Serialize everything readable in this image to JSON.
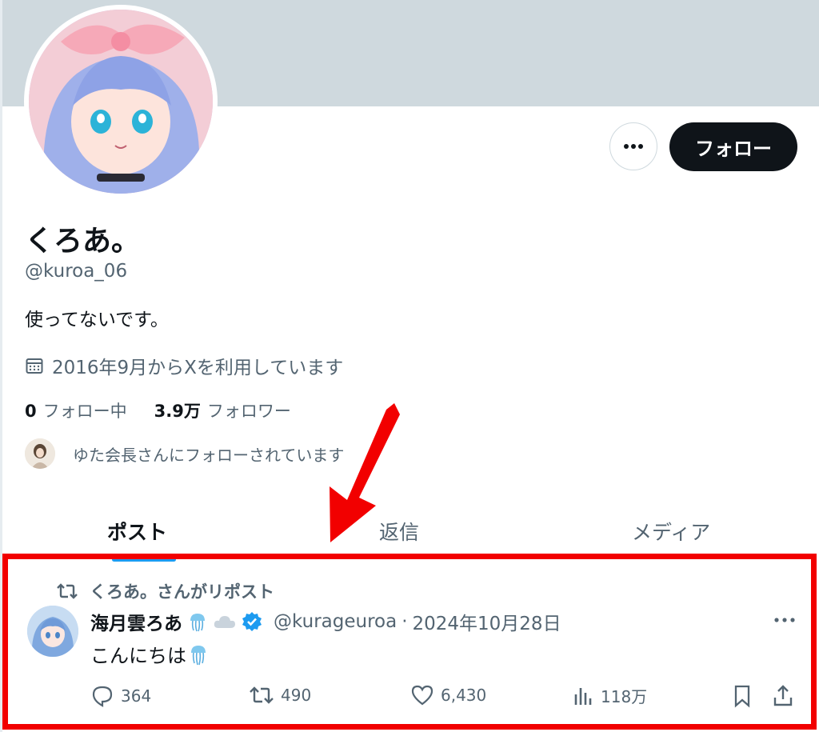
{
  "profile": {
    "display_name": "くろあ。",
    "handle": "@kuroa_06",
    "bio": "使ってないです。",
    "joined": "2016年9月からXを利用しています",
    "following_count": "0",
    "following_label": "フォロー中",
    "followers_count": "3.9万",
    "followers_label": "フォロワー",
    "followed_by": "ゆた会長さんにフォローされています"
  },
  "actions": {
    "follow_label": "フォロー",
    "more_icon": "more-horizontal-icon"
  },
  "tabs": [
    {
      "label": "ポスト",
      "active": true
    },
    {
      "label": "返信",
      "active": false
    },
    {
      "label": "メディア",
      "active": false
    }
  ],
  "post": {
    "repost_label": "くろあ。さんがリポスト",
    "author_name": "海月雲ろあ",
    "author_handle": "@kurageuroa",
    "separator": "·",
    "date": "2024年10月28日",
    "text": "こんにちは",
    "replies": "364",
    "reposts": "490",
    "likes": "6,430",
    "views": "118万"
  },
  "colors": {
    "banner": "#cfd9de",
    "accent": "#1d9bf0",
    "highlight_box": "#f20000",
    "arrow": "#f20000",
    "follow_button": "#0f1419"
  }
}
